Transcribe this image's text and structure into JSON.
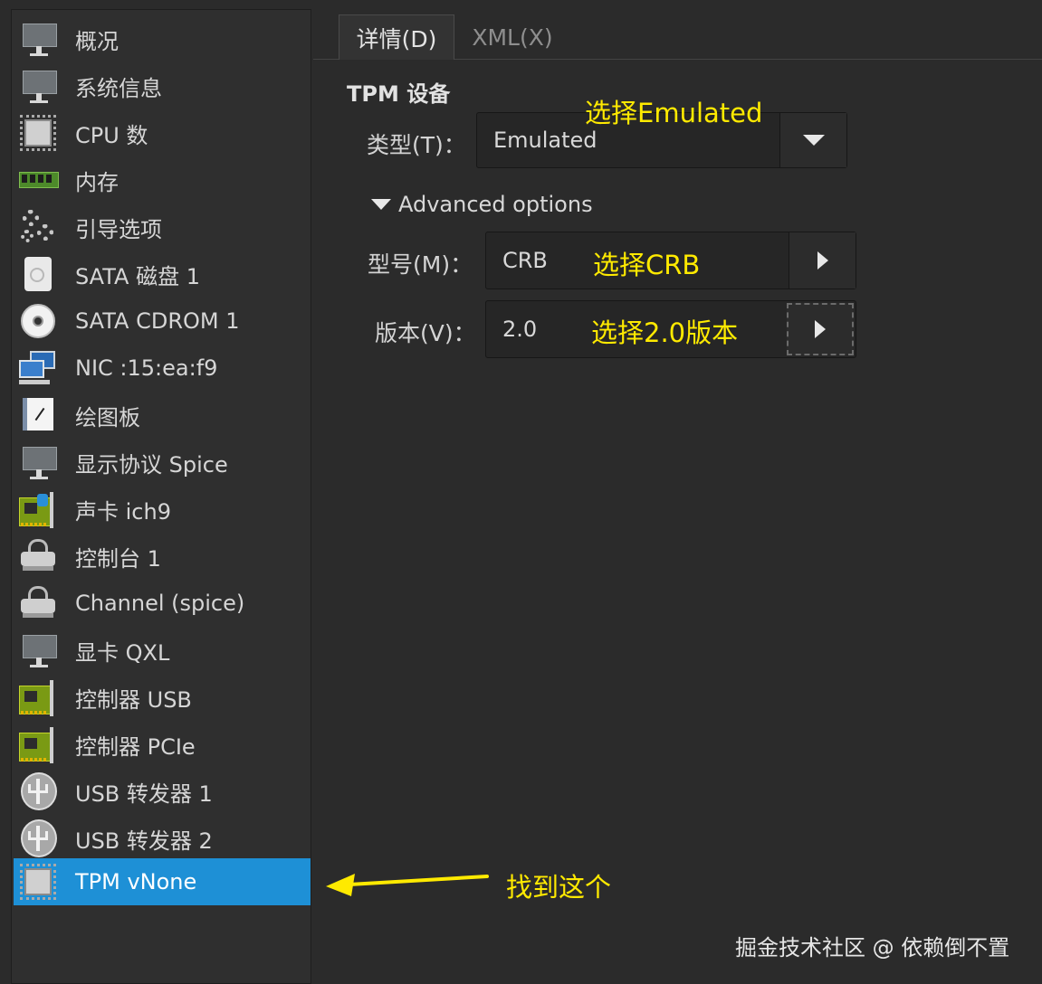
{
  "sidebar": {
    "items": [
      {
        "label": "概况",
        "icon": "monitor-icon"
      },
      {
        "label": "系统信息",
        "icon": "monitor-icon"
      },
      {
        "label": "CPU 数",
        "icon": "cpu-chip-icon"
      },
      {
        "label": "内存",
        "icon": "memory-icon"
      },
      {
        "label": "引导选项",
        "icon": "gears-icon"
      },
      {
        "label": "SATA 磁盘 1",
        "icon": "hard-disk-icon"
      },
      {
        "label": "SATA CDROM 1",
        "icon": "cdrom-icon"
      },
      {
        "label": "NIC :15:ea:f9",
        "icon": "network-icon"
      },
      {
        "label": "绘图板",
        "icon": "tablet-icon"
      },
      {
        "label": "显示协议 Spice",
        "icon": "monitor-icon"
      },
      {
        "label": "声卡 ich9",
        "icon": "sound-card-icon"
      },
      {
        "label": "控制台 1",
        "icon": "serial-icon"
      },
      {
        "label": "Channel (spice)",
        "icon": "serial-icon"
      },
      {
        "label": "显卡 QXL",
        "icon": "monitor-icon"
      },
      {
        "label": "控制器 USB",
        "icon": "pci-card-icon"
      },
      {
        "label": "控制器 PCIe",
        "icon": "pci-card-icon"
      },
      {
        "label": "USB 转发器 1",
        "icon": "usb-icon"
      },
      {
        "label": "USB 转发器 2",
        "icon": "usb-icon"
      },
      {
        "label": "TPM vNone",
        "icon": "tpm-chip-icon",
        "selected": true
      }
    ]
  },
  "tabs": [
    {
      "label": "详情(D)",
      "active": true
    },
    {
      "label": "XML(X)",
      "active": false
    }
  ],
  "tpm": {
    "section_title": "TPM 设备",
    "type_label": "类型(T)：",
    "type_value": "Emulated",
    "advanced_label": "Advanced options",
    "model_label": "型号(M)：",
    "model_value": "CRB",
    "version_label": "版本(V)：",
    "version_value": "2.0"
  },
  "annotations": {
    "type_note": "选择Emulated",
    "model_note": "选择CRB",
    "version_note": "选择2.0版本",
    "find_note": "找到这个"
  },
  "watermark": "掘金技术社区 @ 依赖倒不置",
  "colors": {
    "selection": "#1e90d6",
    "annotation": "#ffea00",
    "background": "#2b2b2b"
  }
}
